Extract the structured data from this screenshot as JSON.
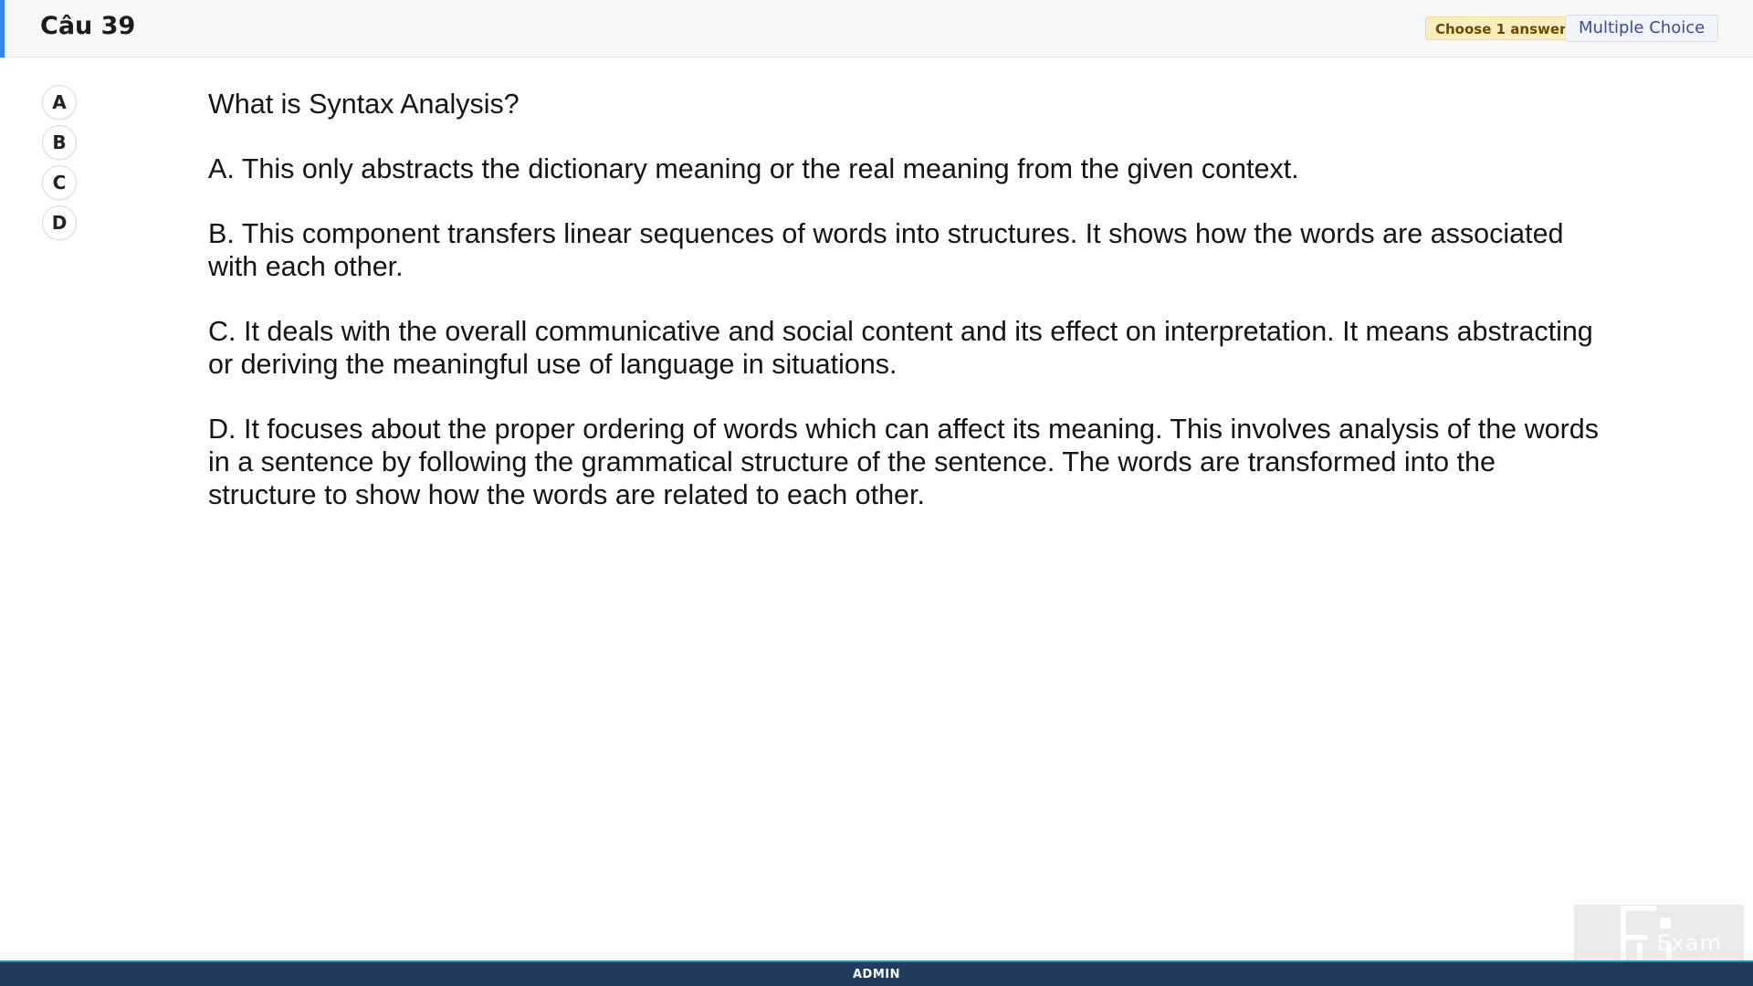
{
  "header": {
    "title": "Câu 39",
    "choose_badge": "Choose 1 answer",
    "type_badge": "Multiple Choice",
    "accent_color": "#3b82f6"
  },
  "answer_options": [
    "A",
    "B",
    "C",
    "D"
  ],
  "question": {
    "prompt": "What is Syntax Analysis?",
    "choices": [
      "A.  This only abstracts the dictionary meaning or the real meaning from the given context.",
      "B.  This component transfers linear sequences of words into structures. It shows how the words are associated with each other.",
      "C.  It deals with the overall communicative and social content and its effect on interpretation. It means abstracting or deriving the meaningful use of language in situations.",
      "D.  It focuses about the proper ordering of words which can affect its meaning. This involves analysis of the words in a sentence by following the grammatical structure of the sentence. The words are transformed into the structure to show how the words are related to each other."
    ]
  },
  "watermark": {
    "text": "Exam",
    "icon": "fu-logo-icon"
  },
  "footer": {
    "label": "ADMIN",
    "background": "#1f3b5e"
  }
}
